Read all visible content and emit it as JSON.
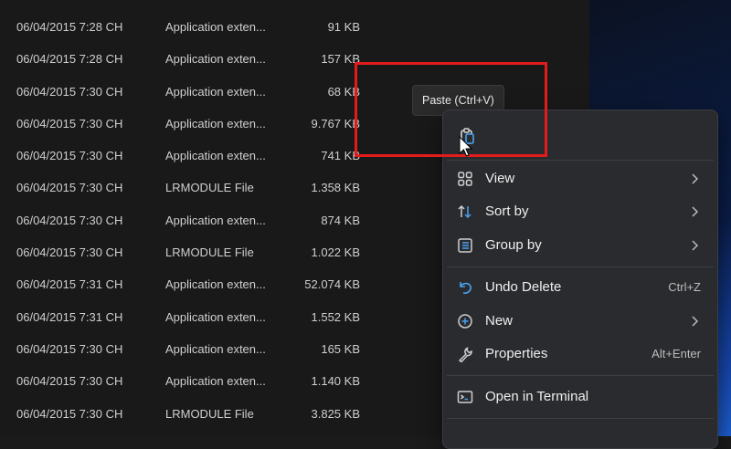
{
  "files": [
    {
      "date": "06/04/2015 7:28 CH",
      "type": "Application exten...",
      "size": "91 KB"
    },
    {
      "date": "06/04/2015 7:28 CH",
      "type": "Application exten...",
      "size": "157 KB"
    },
    {
      "date": "06/04/2015 7:30 CH",
      "type": "Application exten...",
      "size": "68 KB"
    },
    {
      "date": "06/04/2015 7:30 CH",
      "type": "Application exten...",
      "size": "9.767 KB"
    },
    {
      "date": "06/04/2015 7:30 CH",
      "type": "Application exten...",
      "size": "741 KB"
    },
    {
      "date": "06/04/2015 7:30 CH",
      "type": "LRMODULE File",
      "size": "1.358 KB"
    },
    {
      "date": "06/04/2015 7:30 CH",
      "type": "Application exten...",
      "size": "874 KB"
    },
    {
      "date": "06/04/2015 7:30 CH",
      "type": "LRMODULE File",
      "size": "1.022 KB"
    },
    {
      "date": "06/04/2015 7:31 CH",
      "type": "Application exten...",
      "size": "52.074 KB"
    },
    {
      "date": "06/04/2015 7:31 CH",
      "type": "Application exten...",
      "size": "1.552 KB"
    },
    {
      "date": "06/04/2015 7:30 CH",
      "type": "Application exten...",
      "size": "165 KB"
    },
    {
      "date": "06/04/2015 7:30 CH",
      "type": "Application exten...",
      "size": "1.140 KB"
    },
    {
      "date": "06/04/2015 7:30 CH",
      "type": "LRMODULE File",
      "size": "3.825 KB"
    }
  ],
  "tooltip": {
    "text": "Paste (Ctrl+V)"
  },
  "context_menu": {
    "paste_icon": "clipboard-paste-icon",
    "view": {
      "label": "View",
      "icon": "grid-view-icon"
    },
    "sort_by": {
      "label": "Sort by",
      "icon": "sort-arrows-icon"
    },
    "group_by": {
      "label": "Group by",
      "icon": "group-list-icon"
    },
    "undo_delete": {
      "label": "Undo Delete",
      "shortcut": "Ctrl+Z",
      "icon": "undo-icon"
    },
    "new": {
      "label": "New",
      "icon": "plus-circle-icon"
    },
    "properties": {
      "label": "Properties",
      "shortcut": "Alt+Enter",
      "icon": "wrench-icon"
    },
    "open_terminal": {
      "label": "Open in Terminal",
      "icon": "terminal-icon"
    }
  },
  "colors": {
    "highlight_box": "#e21b1b",
    "accent_blue": "#4aa3f0",
    "menu_bg": "#2a2b2e",
    "explorer_bg": "#191919"
  }
}
